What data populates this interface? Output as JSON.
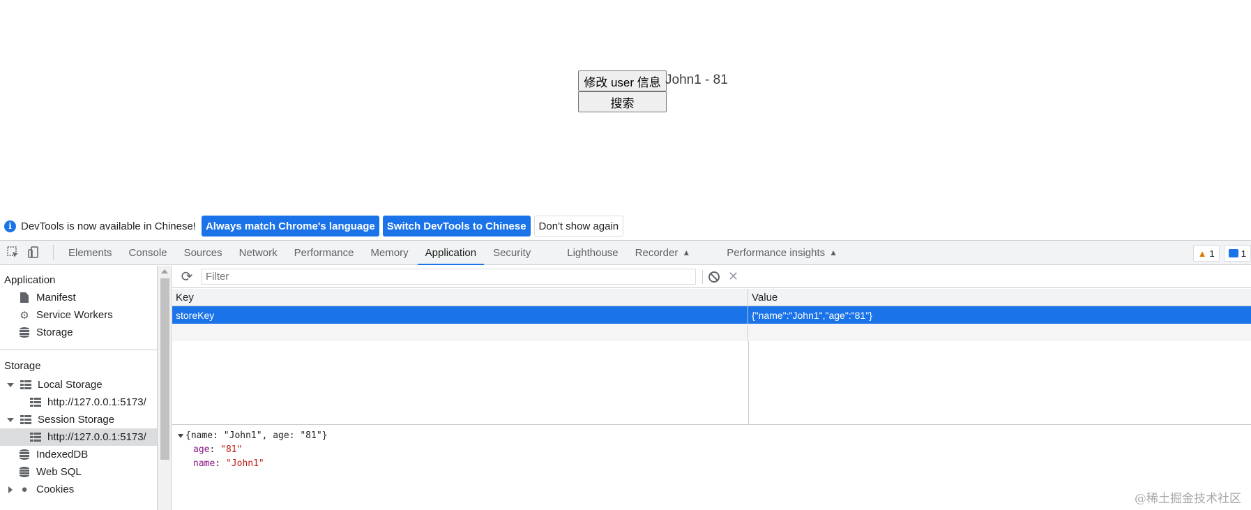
{
  "page": {
    "edit_button": "修改 user 信息",
    "search_button": "搜索",
    "user_text": "John1 - 81"
  },
  "infobar": {
    "icon": "info-icon",
    "message": "DevTools is now available in Chinese!",
    "btn_match": "Always match Chrome's language",
    "btn_switch": "Switch DevTools to Chinese",
    "btn_dismiss": "Don't show again"
  },
  "tabs": [
    {
      "label": "Elements"
    },
    {
      "label": "Console"
    },
    {
      "label": "Sources"
    },
    {
      "label": "Network"
    },
    {
      "label": "Performance"
    },
    {
      "label": "Memory"
    },
    {
      "label": "Application",
      "active": true
    },
    {
      "label": "Security"
    },
    {
      "label": "Lighthouse"
    },
    {
      "label": "Recorder",
      "experimental": true
    },
    {
      "label": "Performance insights",
      "experimental": true
    }
  ],
  "badges": {
    "warnings": "1",
    "messages": "1"
  },
  "sidebar": {
    "application_title": "Application",
    "application_items": [
      "Manifest",
      "Service Workers",
      "Storage"
    ],
    "storage_title": "Storage",
    "local_storage": "Local Storage",
    "local_origin": "http://127.0.0.1:5173/",
    "session_storage": "Session Storage",
    "session_origin": "http://127.0.0.1:5173/",
    "indexeddb": "IndexedDB",
    "websql": "Web SQL",
    "cookies": "Cookies"
  },
  "toolbar": {
    "filter_placeholder": "Filter"
  },
  "table": {
    "headers": {
      "key": "Key",
      "value": "Value"
    },
    "rows": [
      {
        "key": "storeKey",
        "value": "{\"name\":\"John1\",\"age\":\"81\"}"
      }
    ]
  },
  "preview": {
    "summary": "{name: \"John1\", age: \"81\"}",
    "props": [
      {
        "key": "age",
        "value": "\"81\""
      },
      {
        "key": "name",
        "value": "\"John1\""
      }
    ]
  },
  "watermark": "@稀土掘金技术社区",
  "colors": {
    "accent": "#1a73e8",
    "warning": "#e37400"
  }
}
